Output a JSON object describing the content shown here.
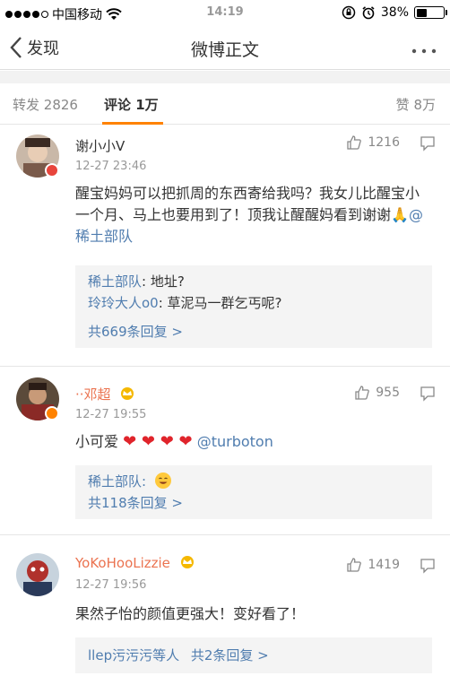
{
  "status_bar": {
    "carrier": "中国移动",
    "time": "14:19",
    "battery": "38%",
    "battery_level": 0.38
  },
  "nav": {
    "back_label": "发现",
    "title": "微博正文"
  },
  "tabs": {
    "repost_label": "转发",
    "repost_count": "2826",
    "comment_label": "评论",
    "comment_count": "1万",
    "like_label": "赞",
    "like_count": "8万"
  },
  "comments": [
    {
      "user": "谢小小V",
      "time": "12-27 23:46",
      "likes": "1216",
      "text": "醒宝妈妈可以把抓周的东西寄给我吗？我女儿比醒宝小一个月、马上也要用到了！顶我让醒醒妈看到谢谢🙏",
      "mention": "@稀土部队",
      "replies": [
        {
          "user": "稀土部队",
          "text": ": 地址?"
        },
        {
          "user": "玲玲大人o0",
          "text": ": 草泥马一群乞丐呢?"
        }
      ],
      "more_replies": "共669条回复 >"
    },
    {
      "user": "··邓超",
      "time": "12-27 19:55",
      "likes": "955",
      "text_prefix": "小可爱",
      "hearts": "❤ ❤ ❤ ❤",
      "mention": "@turboton",
      "replies": [
        {
          "user": "稀土部队",
          "text": ":"
        }
      ],
      "more_replies": "共118条回复 >"
    },
    {
      "user": "YoKoHooLizzie",
      "time": "12-27 19:56",
      "likes": "1419",
      "text": "果然子怡的颜值更强大！变好看了！",
      "replies_summary_users": "llep污污污等人",
      "replies_summary_count": "共2条回复 >"
    }
  ],
  "colors": {
    "accent": "#ff8200",
    "link": "#507daf",
    "name_orange": "#eb7350"
  }
}
